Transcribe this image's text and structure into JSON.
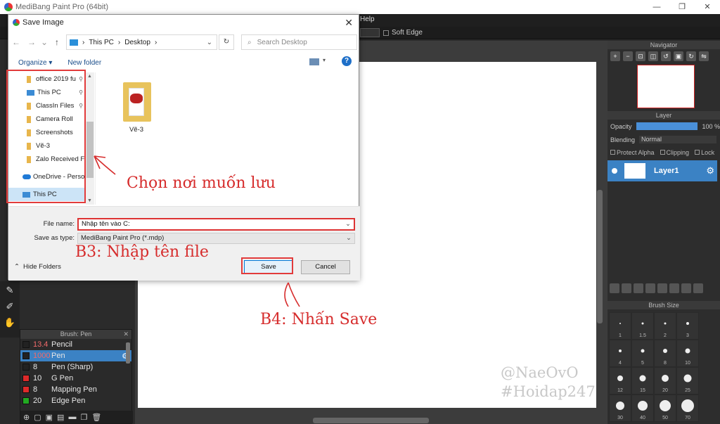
{
  "app": {
    "title": "MediBang Paint Pro (64bit)",
    "menu_help": "Help",
    "toolbar_soft_edge": "Soft Edge",
    "win_min": "—",
    "win_max": "❐",
    "win_close": "✕"
  },
  "brush_panel": {
    "title": "Brush: Pen",
    "items": [
      {
        "size": "13.4",
        "name": "Pencil",
        "color": "#222222",
        "size_red": true
      },
      {
        "size": "1000",
        "name": "Pen",
        "color": "#222222",
        "size_red": true
      },
      {
        "size": "8",
        "name": "Pen (Sharp)",
        "color": "#222222",
        "size_red": false
      },
      {
        "size": "10",
        "name": "G Pen",
        "color": "#dd2a2a",
        "size_red": false
      },
      {
        "size": "8",
        "name": "Mapping Pen",
        "color": "#dd2a2a",
        "size_red": false
      },
      {
        "size": "20",
        "name": "Edge Pen",
        "color": "#22aa22",
        "size_red": false
      }
    ]
  },
  "navigator": {
    "title": "Navigator"
  },
  "layer_panel": {
    "title": "Layer",
    "opacity_label": "Opacity",
    "opacity_value": "100 %",
    "opacity_fraction": 1.0,
    "blending_label": "Blending",
    "blending_value": "Normal",
    "protect_alpha": "Protect Alpha",
    "clipping": "Clipping",
    "lock": "Lock",
    "layer_name": "Layer1"
  },
  "brush_size": {
    "title": "Brush Size",
    "sizes": [
      "1",
      "1.5",
      "2",
      "3",
      "4",
      "5",
      "8",
      "10",
      "12",
      "15",
      "20",
      "25",
      "30",
      "40",
      "50",
      "70"
    ]
  },
  "dialog": {
    "title": "Save Image",
    "close": "✕",
    "breadcrumb": [
      "This PC",
      "Desktop"
    ],
    "search_placeholder": "Search Desktop",
    "organize": "Organize ▾",
    "new_folder": "New folder",
    "help": "?",
    "nav_items": [
      {
        "label": "office 2019 fu",
        "icon": "folder",
        "pinned": true
      },
      {
        "label": "This PC",
        "icon": "pc",
        "pinned": true
      },
      {
        "label": "ClassIn Files",
        "icon": "folder",
        "pinned": true
      },
      {
        "label": "Camera Roll",
        "icon": "folder",
        "pinned": false
      },
      {
        "label": "Screenshots",
        "icon": "folder",
        "pinned": false
      },
      {
        "label": "Vẽ-3",
        "icon": "folder",
        "pinned": false
      },
      {
        "label": "Zalo Received Fil",
        "icon": "folder",
        "pinned": false
      },
      {
        "label": "OneDrive - Person",
        "icon": "cloud",
        "pinned": false
      },
      {
        "label": "This PC",
        "icon": "pc",
        "pinned": false,
        "selected": true
      }
    ],
    "files": [
      {
        "name": "Vẽ-3"
      }
    ],
    "file_name_label": "File name:",
    "file_name_value": "Nhập tên vào C:",
    "save_type_label": "Save as type:",
    "save_type_value": "MediBang Paint Pro (*.mdp)",
    "hide_folders": "Hide Folders",
    "save": "Save",
    "cancel": "Cancel"
  },
  "annotations": {
    "choose_location": "Chọn nơi muốn lưu",
    "step3": "B3: Nhập tên file",
    "step4": "B4: Nhấn Save",
    "watermark_1": "@NaeOvO",
    "watermark_2": "#Hoidap247",
    "color": "#d62c2c"
  }
}
